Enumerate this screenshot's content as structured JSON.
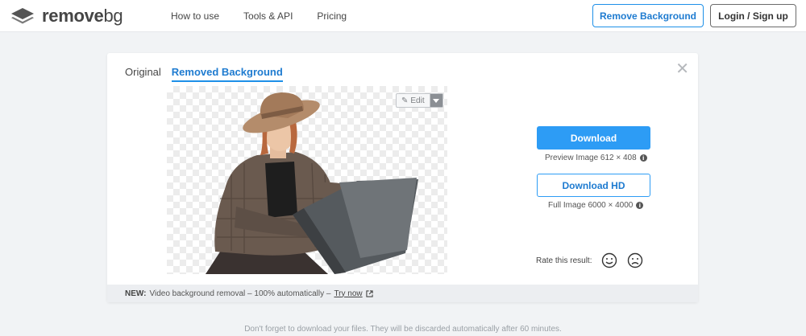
{
  "header": {
    "logo_name": "remove",
    "logo_suffix": "bg",
    "logo_icon": "layers-icon",
    "nav": [
      {
        "label": "How to use"
      },
      {
        "label": "Tools & API"
      },
      {
        "label": "Pricing"
      }
    ],
    "remove_bg_button": "Remove Background",
    "login_button": "Login / Sign up"
  },
  "card": {
    "tabs": [
      {
        "label": "Original",
        "active": false
      },
      {
        "label": "Removed Background",
        "active": true
      }
    ],
    "close_icon": "close-icon",
    "edit_label": "Edit",
    "download": {
      "label": "Download",
      "meta": "Preview Image 612 × 408"
    },
    "download_hd": {
      "label": "Download HD",
      "meta": "Full Image 6000 × 4000"
    },
    "rate_label": "Rate this result:",
    "footer": {
      "new_label": "NEW:",
      "text": "Video background removal – 100% automatically –",
      "link": "Try now"
    }
  },
  "bottom_note": "Don't forget to download your files. They will be discarded automatically after 60 minutes.",
  "colors": {
    "accent": "#2d9cf5",
    "accent_text": "#1e7bd0",
    "page_bg": "#f1f3f5"
  }
}
